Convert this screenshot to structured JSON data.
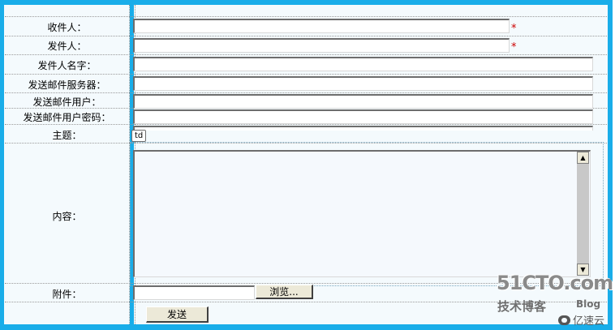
{
  "form": {
    "fields": [
      {
        "label": "收件人：",
        "required": true
      },
      {
        "label": "发件人：",
        "required": true
      },
      {
        "label": "发件人名字：",
        "required": false
      },
      {
        "label": "发送邮件服务器：",
        "required": false
      },
      {
        "label": "发送邮件用户：",
        "required": false
      },
      {
        "label": "发送邮件用户密码：",
        "required": false
      },
      {
        "label": "主题：",
        "required": false
      }
    ],
    "required_marker": "*",
    "content_label": "内容：",
    "attachment_label": "附件：",
    "browse_button": "浏览...",
    "send_button": "发送",
    "td_tag": "td"
  },
  "watermark": {
    "logo": "51CTO.com",
    "subtitle": "技术博客",
    "blog": "Blog",
    "yisu": "亿速云"
  },
  "colors": {
    "frame_blue": "#19ade9",
    "form_background": "#f4fafd",
    "required_red": "#cc0000"
  }
}
